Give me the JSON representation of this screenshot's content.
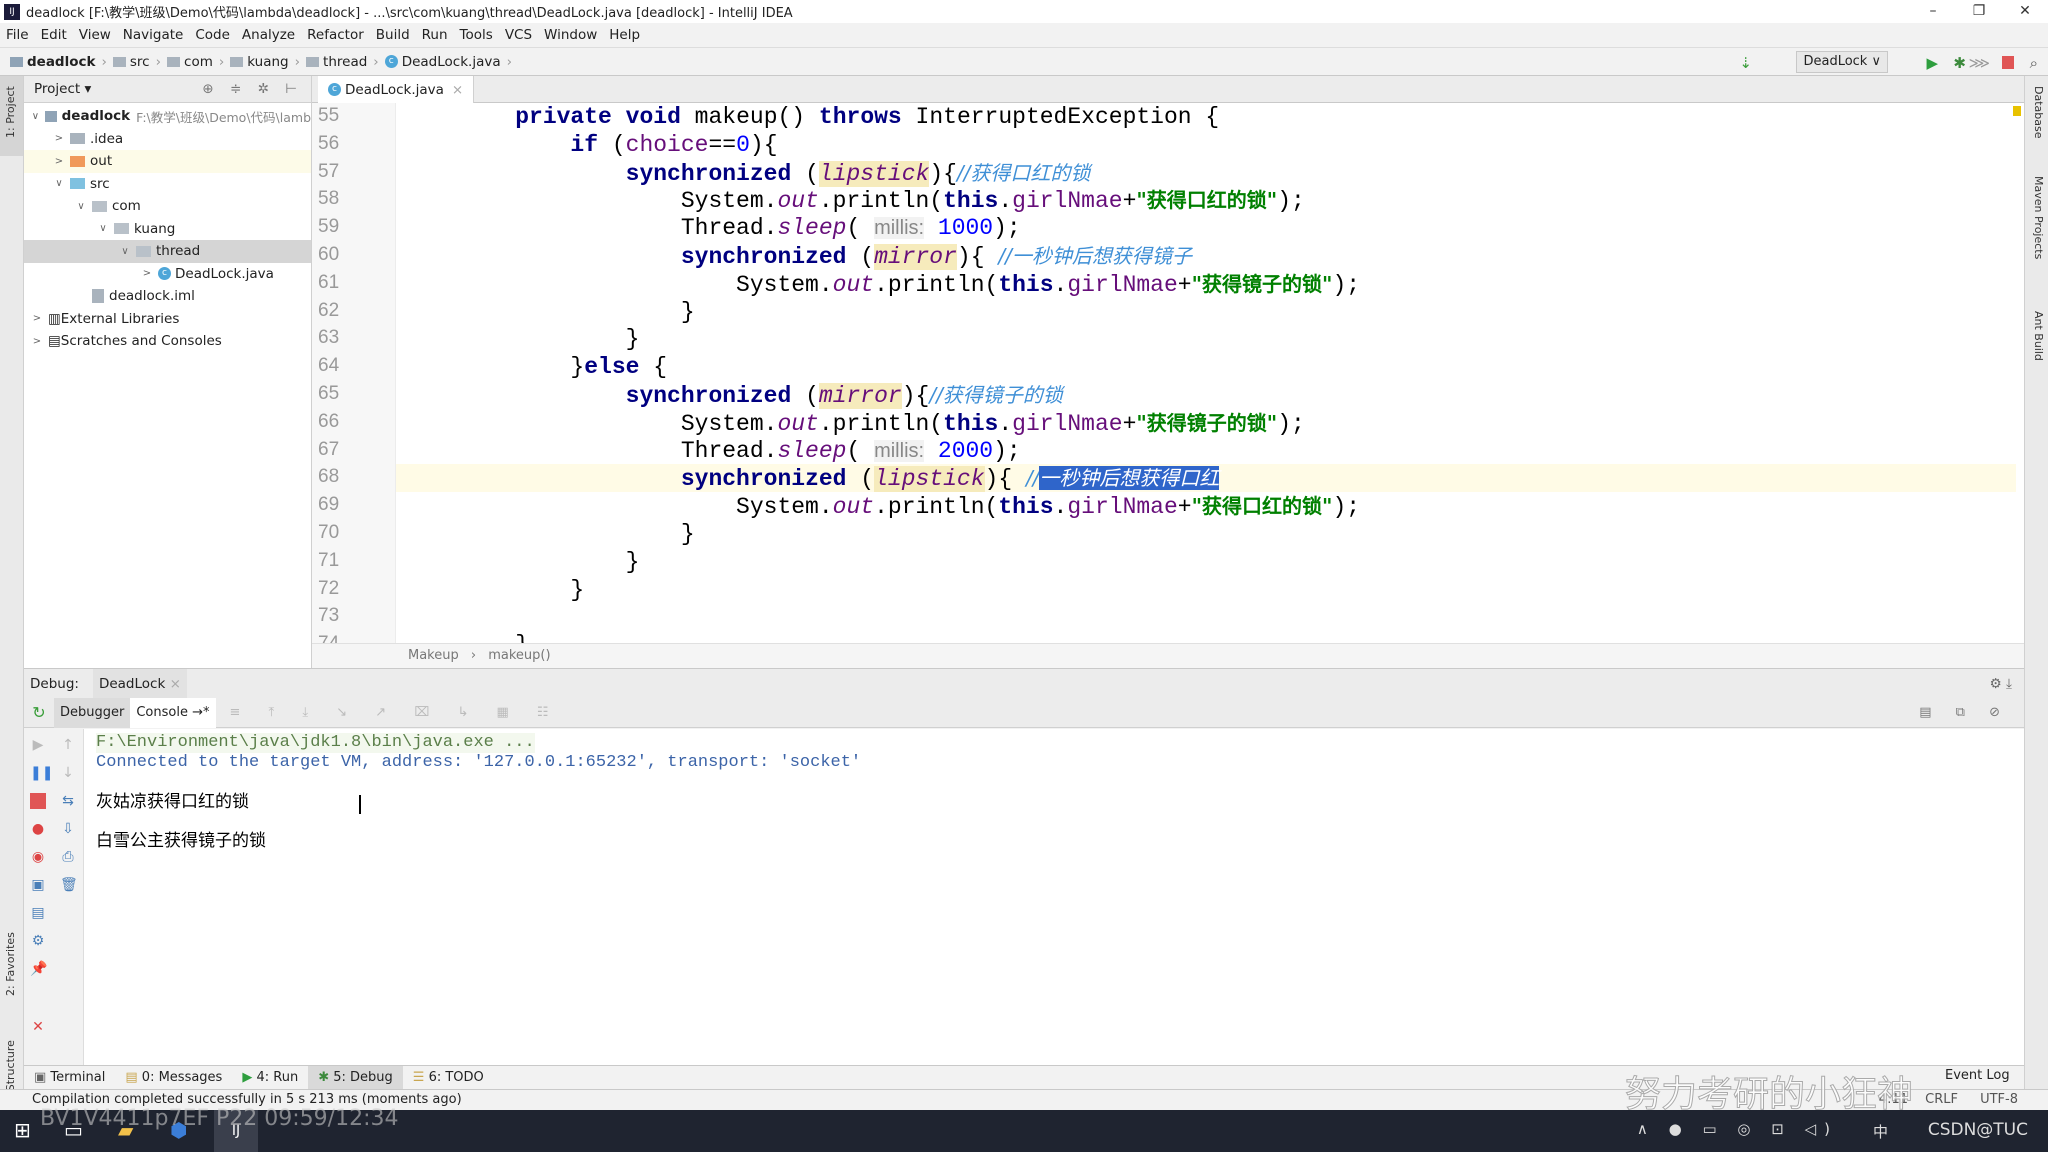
{
  "window": {
    "title": "deadlock [F:\\教学\\班级\\Demo\\代码\\lambda\\deadlock] - ...\\src\\com\\kuang\\thread\\DeadLock.java [deadlock] - IntelliJ IDEA",
    "minimize": "–",
    "maximize": "❐",
    "close": "✕"
  },
  "menu": [
    "File",
    "Edit",
    "View",
    "Navigate",
    "Code",
    "Analyze",
    "Refactor",
    "Build",
    "Run",
    "Tools",
    "VCS",
    "Window",
    "Help"
  ],
  "breadcrumb": [
    "deadlock",
    "src",
    "com",
    "kuang",
    "thread",
    "DeadLock.java"
  ],
  "toolbar": {
    "run_config": "DeadLock ∨"
  },
  "project": {
    "header": "Project ▾",
    "tree": [
      {
        "label": "deadlock",
        "path": "F:\\教学\\班级\\Demo\\代码\\lamb",
        "depth": 0,
        "arrow": "∨",
        "bold": true
      },
      {
        "label": ".idea",
        "depth": 1,
        "arrow": ">",
        "color": "#a9b3bd"
      },
      {
        "label": "out",
        "depth": 1,
        "arrow": ">",
        "color": "#f0995a",
        "highlight": "#fdfbe8"
      },
      {
        "label": "src",
        "depth": 1,
        "arrow": "∨",
        "color": "#7fc1e0"
      },
      {
        "label": "com",
        "depth": 2,
        "arrow": "∨",
        "color": "#b9c1c9"
      },
      {
        "label": "kuang",
        "depth": 3,
        "arrow": "∨",
        "color": "#b9c1c9"
      },
      {
        "label": "thread",
        "depth": 4,
        "arrow": "∨",
        "color": "#b9c1c9",
        "highlight": "#d5d5d5"
      },
      {
        "label": "DeadLock.java",
        "depth": 5,
        "arrow": ">",
        "icon": "class"
      },
      {
        "label": "deadlock.iml",
        "depth": 2,
        "arrow": "",
        "icon": "file"
      },
      {
        "label": "External Libraries",
        "depth": 0,
        "arrow": ">",
        "icon": "lib"
      },
      {
        "label": "Scratches and Consoles",
        "depth": 0,
        "arrow": ">",
        "icon": "scratch"
      }
    ]
  },
  "side_labels": {
    "left_top": "1: Project",
    "left_fav": "2: Favorites",
    "left_struct": "Z: Structure",
    "right_db": "Database",
    "right_maven": "Maven Projects",
    "right_ant": "Ant Build"
  },
  "editor": {
    "tab": "DeadLock.java",
    "current_line": 68,
    "lines": [
      {
        "n": "55",
        "tokens": [
          [
            "    "
          ],
          [
            "private",
            "k"
          ],
          [
            " "
          ],
          [
            "void",
            "k"
          ],
          [
            " makeup() "
          ],
          [
            "throws",
            "k"
          ],
          [
            " InterruptedException {"
          ]
        ]
      },
      {
        "n": "56",
        "tokens": [
          [
            "        "
          ],
          [
            "if",
            "k"
          ],
          [
            " ("
          ],
          [
            "choice",
            "f"
          ],
          [
            "=="
          ],
          [
            "0",
            "n"
          ],
          [
            "){"
          ]
        ]
      },
      {
        "n": "57",
        "tokens": [
          [
            "            "
          ],
          [
            "synchronized",
            "k"
          ],
          [
            " ("
          ],
          [
            "lipstick",
            "fi"
          ],
          [
            "){"
          ],
          [
            "//获得口红的锁",
            "cm"
          ]
        ]
      },
      {
        "n": "58",
        "tokens": [
          [
            "                System."
          ],
          [
            "out",
            "st"
          ],
          [
            ".println("
          ],
          [
            "this",
            "k"
          ],
          [
            "."
          ],
          [
            "girlNmae",
            "f"
          ],
          [
            "+"
          ],
          [
            "\"获得口红的锁\"",
            "s"
          ],
          [
            ");"
          ]
        ]
      },
      {
        "n": "59",
        "tokens": [
          [
            "                Thread."
          ],
          [
            "sleep",
            "st"
          ],
          [
            "( "
          ],
          [
            "millis:",
            "h"
          ],
          [
            " "
          ],
          [
            "1000",
            "n"
          ],
          [
            ");"
          ]
        ]
      },
      {
        "n": "60",
        "tokens": [
          [
            "                "
          ],
          [
            "synchronized",
            "k"
          ],
          [
            " ("
          ],
          [
            "mirror",
            "fi"
          ],
          [
            "){ "
          ],
          [
            "//一秒钟后想获得镜子",
            "cm"
          ]
        ]
      },
      {
        "n": "61",
        "tokens": [
          [
            "                    System."
          ],
          [
            "out",
            "st"
          ],
          [
            ".println("
          ],
          [
            "this",
            "k"
          ],
          [
            "."
          ],
          [
            "girlNmae",
            "f"
          ],
          [
            "+"
          ],
          [
            "\"获得镜子的锁\"",
            "s"
          ],
          [
            ");"
          ]
        ]
      },
      {
        "n": "62",
        "tokens": [
          [
            "                }"
          ]
        ]
      },
      {
        "n": "63",
        "tokens": [
          [
            "            }"
          ]
        ]
      },
      {
        "n": "64",
        "tokens": [
          [
            "        }"
          ],
          [
            "else",
            "k"
          ],
          [
            " {"
          ]
        ]
      },
      {
        "n": "65",
        "tokens": [
          [
            "            "
          ],
          [
            "synchronized",
            "k"
          ],
          [
            " ("
          ],
          [
            "mirror",
            "fi"
          ],
          [
            "){"
          ],
          [
            "//获得镜子的锁",
            "cm"
          ]
        ]
      },
      {
        "n": "66",
        "tokens": [
          [
            "                System."
          ],
          [
            "out",
            "st"
          ],
          [
            ".println("
          ],
          [
            "this",
            "k"
          ],
          [
            "."
          ],
          [
            "girlNmae",
            "f"
          ],
          [
            "+"
          ],
          [
            "\"获得镜子的锁\"",
            "s"
          ],
          [
            ");"
          ]
        ]
      },
      {
        "n": "67",
        "tokens": [
          [
            "                Thread."
          ],
          [
            "sleep",
            "st"
          ],
          [
            "( "
          ],
          [
            "millis:",
            "h"
          ],
          [
            " "
          ],
          [
            "2000",
            "n"
          ],
          [
            ");"
          ]
        ]
      },
      {
        "n": "68",
        "tokens": [
          [
            "                "
          ],
          [
            "synchronized",
            "k"
          ],
          [
            " ("
          ],
          [
            "lipstick",
            "fi"
          ],
          [
            "){ "
          ],
          [
            "//",
            "cm"
          ],
          [
            "一秒钟后想获得口红",
            "cm sel"
          ]
        ]
      },
      {
        "n": "69",
        "tokens": [
          [
            "                    System."
          ],
          [
            "out",
            "st"
          ],
          [
            ".println("
          ],
          [
            "this",
            "k"
          ],
          [
            "."
          ],
          [
            "girlNmae",
            "f"
          ],
          [
            "+"
          ],
          [
            "\"获得口红的锁\"",
            "s"
          ],
          [
            ");"
          ]
        ]
      },
      {
        "n": "70",
        "tokens": [
          [
            "                }"
          ]
        ]
      },
      {
        "n": "71",
        "tokens": [
          [
            "            }"
          ]
        ]
      },
      {
        "n": "72",
        "tokens": [
          [
            "        }"
          ]
        ]
      },
      {
        "n": "73",
        "tokens": [
          [
            ""
          ]
        ]
      },
      {
        "n": "74",
        "tokens": [
          [
            "    }"
          ]
        ]
      }
    ],
    "breadcrumb": [
      "Makeup",
      "makeup()"
    ]
  },
  "debug": {
    "label": "Debug:",
    "session": "DeadLock",
    "tabs": [
      "Debugger",
      "Console →*"
    ],
    "console": [
      {
        "text": "F:\\Environment\\java\\jdk1.8\\bin\\java.exe ...",
        "color": "#5b7f4a",
        "bg": "#f3f8ee"
      },
      {
        "text": "Connected to the target VM, address: '127.0.0.1:65232', transport: 'socket'",
        "color": "#3c64a8"
      },
      {
        "text": "灰姑凉获得口红的锁",
        "color": "#000"
      },
      {
        "text": "白雪公主获得镜子的锁",
        "color": "#000"
      }
    ]
  },
  "bottom_tabs": [
    "Terminal",
    "0: Messages",
    "4: Run",
    "5: Debug",
    "6: TODO"
  ],
  "event_log": "Event Log",
  "status": {
    "message": "Compilation completed successfully in 5 s 213 ms (moments ago)",
    "position": "4:11",
    "line_sep": "CRLF",
    "encoding": "UTF-8"
  },
  "overlay": {
    "video_id": "BV1V4411p7EF P22 09:59/12:34",
    "watermark": "努力考研的小狂神",
    "tray": "CSDN@TUC",
    "ime": "中"
  }
}
